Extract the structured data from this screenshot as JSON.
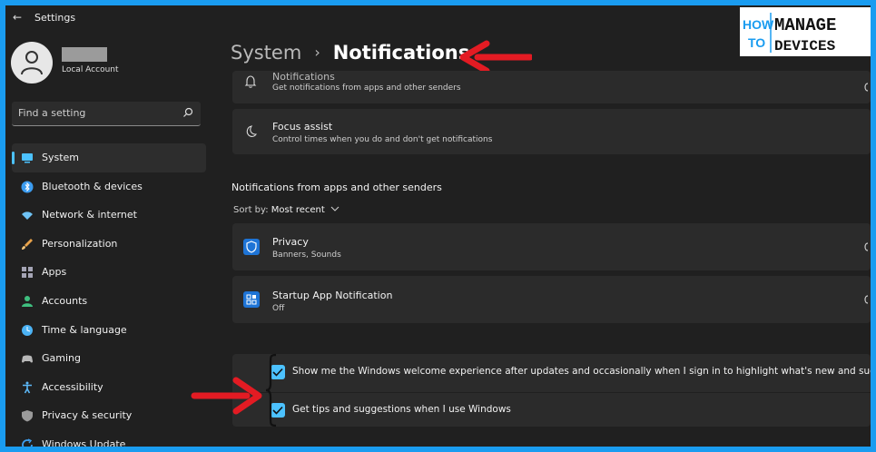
{
  "window": {
    "title": "Settings"
  },
  "user": {
    "account_type": "Local Account"
  },
  "search": {
    "placeholder": "Find a setting"
  },
  "nav": [
    {
      "label": "System",
      "icon": "monitor-icon",
      "color": "#4cc2ff",
      "active": true
    },
    {
      "label": "Bluetooth & devices",
      "icon": "bluetooth-icon",
      "color": "#3b9cf0"
    },
    {
      "label": "Network & internet",
      "icon": "wifi-icon",
      "color": "#6fc3f5"
    },
    {
      "label": "Personalization",
      "icon": "brush-icon",
      "color": "#e8a24a"
    },
    {
      "label": "Apps",
      "icon": "apps-icon",
      "color": "#a5a5b5"
    },
    {
      "label": "Accounts",
      "icon": "person-icon",
      "color": "#3fbf7f"
    },
    {
      "label": "Time & language",
      "icon": "globe-clock-icon",
      "color": "#4cb3f5"
    },
    {
      "label": "Gaming",
      "icon": "controller-icon",
      "color": "#b8b8b8"
    },
    {
      "label": "Accessibility",
      "icon": "accessibility-icon",
      "color": "#5db8f7"
    },
    {
      "label": "Privacy & security",
      "icon": "shield-icon",
      "color": "#9a9a9a"
    },
    {
      "label": "Windows Update",
      "icon": "update-icon",
      "color": "#3e9ff0"
    }
  ],
  "breadcrumb": {
    "parent": "System",
    "separator": "›",
    "current": "Notifications"
  },
  "cards": {
    "notifications": {
      "title": "Notifications",
      "subtitle": "Get notifications from apps and other senders"
    },
    "focus_assist": {
      "title": "Focus assist",
      "subtitle": "Control times when you do and don't get notifications"
    }
  },
  "apps_section": {
    "heading": "Notifications from apps and other senders",
    "sort_label": "Sort by:",
    "sort_value": "Most recent",
    "apps": [
      {
        "title": "Privacy",
        "subtitle": "Banners, Sounds"
      },
      {
        "title": "Startup App Notification",
        "subtitle": "Off"
      }
    ]
  },
  "checkboxes": [
    {
      "label": "Show me the Windows welcome experience after updates and occasionally when I sign in to highlight what's new and suggested",
      "checked": true
    },
    {
      "label": "Get tips and suggestions when I use Windows",
      "checked": true
    }
  ],
  "logo": {
    "word1": "HOW",
    "word2": "TO",
    "word3": "MANAGE",
    "word4": "DEVICES"
  },
  "colors": {
    "accent": "#4cc2ff",
    "annotation": "#e31b23",
    "frame": "#1a9cf0"
  }
}
